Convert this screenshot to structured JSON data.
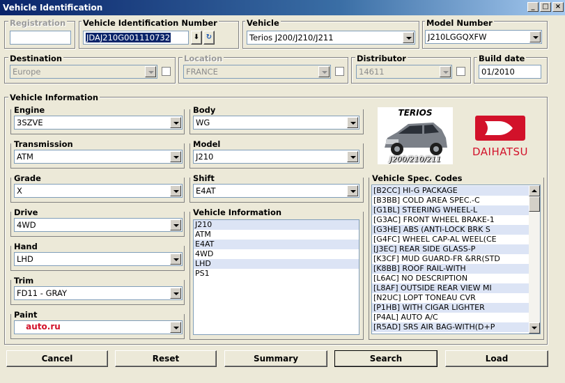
{
  "window": {
    "title": "Vehicle Identification",
    "title_buttons": [
      "_",
      "□",
      "×"
    ]
  },
  "top": {
    "registration": {
      "label": "Registration",
      "value": ""
    },
    "vin": {
      "label": "Vehicle Identification Number",
      "value": "JDAJ210G001110732"
    },
    "vehicle": {
      "label": "Vehicle",
      "value": "Terios J200/J210/J211"
    },
    "model_number": {
      "label": "Model Number",
      "value": "J210LGGQXFW"
    }
  },
  "mid": {
    "destination": {
      "label": "Destination",
      "value": "Europe"
    },
    "location": {
      "label": "Location",
      "value": "FRANCE"
    },
    "distributor": {
      "label": "Distributor",
      "value": "14611"
    },
    "build_date": {
      "label": "Build date",
      "value": "01/2010"
    }
  },
  "vehicle_info_group": {
    "label": "Vehicle Information",
    "engine": {
      "label": "Engine",
      "value": "3SZVE"
    },
    "body": {
      "label": "Body",
      "value": "WG"
    },
    "transmission": {
      "label": "Transmission",
      "value": "ATM"
    },
    "model": {
      "label": "Model",
      "value": "J210"
    },
    "grade": {
      "label": "Grade",
      "value": "X"
    },
    "shift": {
      "label": "Shift",
      "value": "E4AT"
    },
    "drive": {
      "label": "Drive",
      "value": "4WD"
    },
    "hand": {
      "label": "Hand",
      "value": "LHD"
    },
    "trim": {
      "label": "Trim",
      "value": "FD11 - GRAY"
    },
    "paint": {
      "label": "Paint",
      "value": ""
    },
    "info_list_label": "Vehicle Information",
    "info_list": [
      "J210",
      "ATM",
      "E4AT",
      "4WD",
      "LHD",
      "PS1"
    ]
  },
  "branding": {
    "car_name": "TERIOS",
    "car_codes": "J200/210/211",
    "brand_name": "DAIHATSU",
    "watermark": "auto.ru",
    "brand_color": "#d2112a"
  },
  "spec_codes": {
    "label": "Vehicle Spec. Codes",
    "items": [
      "[B2CC] HI-G PACKAGE",
      "[B3BB] COLD AREA SPEC.-C",
      "[G1BL] STEERING WHEEL-L",
      "[G3AC] FRONT WHEEL BRAKE-1",
      "[G3HE] ABS (ANTI-LOCK BRK S",
      "[G4FC] WHEEL CAP-AL WEEL(CE",
      "[J3EC] REAR SIDE GLASS-P",
      "[K3CF] MUD GUARD-FR &RR(STD",
      "[K8BB] ROOF RAIL-WITH",
      "[L6AC] NO DESCRIPTION",
      "[L8AF] OUTSIDE REAR VIEW MI",
      "[N2UC] LOPT TONEAU CVR",
      "[P1HB] WITH CIGAR LIGHTER",
      "[P4AL] AUTO A/C",
      "[R5AD] SRS AIR BAG-WITH(D+P"
    ]
  },
  "buttons": {
    "cancel": "Cancel",
    "reset": "Reset",
    "summary": "Summary",
    "search": "Search",
    "load": "Load"
  }
}
